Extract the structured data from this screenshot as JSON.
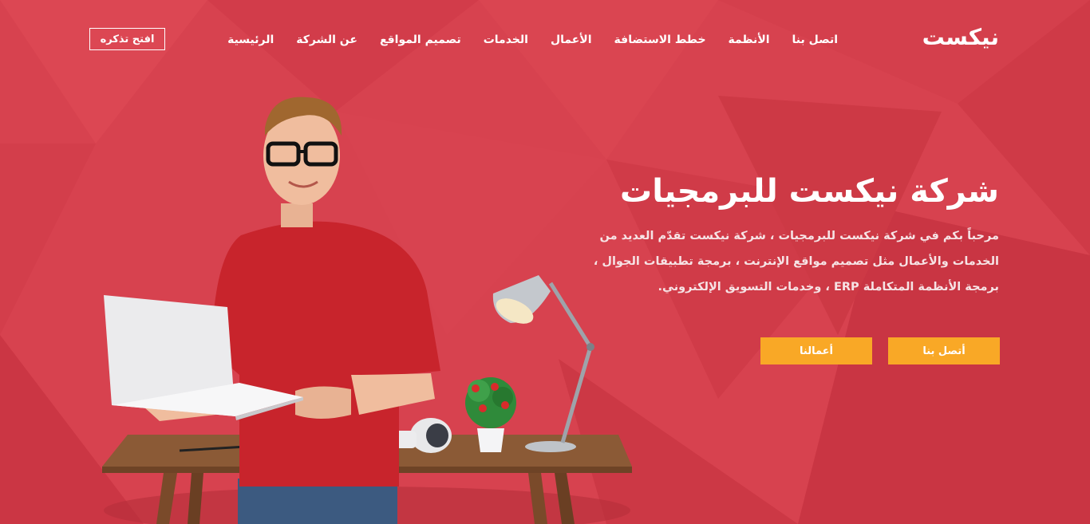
{
  "brand": {
    "logo": "نيكست"
  },
  "nav": {
    "items": [
      {
        "label": "الرئيسية",
        "name": "nav-home"
      },
      {
        "label": "عن الشركة",
        "name": "nav-about"
      },
      {
        "label": "تصميم المواقع",
        "name": "nav-web-design"
      },
      {
        "label": "الخدمات",
        "name": "nav-services"
      },
      {
        "label": "الأعمال",
        "name": "nav-works"
      },
      {
        "label": "خطط الاستضافة",
        "name": "nav-hosting"
      },
      {
        "label": "الأنظمة",
        "name": "nav-systems"
      },
      {
        "label": "اتصل بنا",
        "name": "nav-contact"
      }
    ],
    "ticket_button": "افتح تذكره"
  },
  "hero": {
    "title": "شركة نيكست للبرمجيات",
    "description_lines": [
      "مرحباً بكم في شركة نيكست للبرمجيات ، شركة نيكست تقدّم العديد من",
      "الخدمات والأعمال مثل تصميم مواقع الإنترنت ، برمجة تطبيقات الجوال ،",
      "برمجة الأنظمة المتكاملة ERP ، وخدمات التسويق الإلكتروني."
    ],
    "contact_button": "أتصل بنا",
    "works_button": "أعمالنا"
  },
  "colors": {
    "background": "#d7424f",
    "accent": "#f9a826"
  }
}
